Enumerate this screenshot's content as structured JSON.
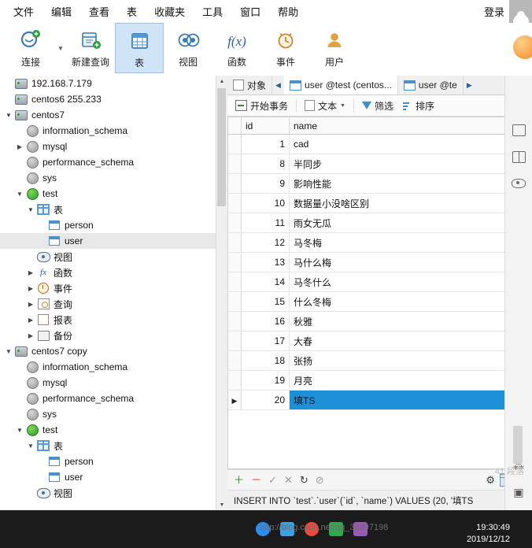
{
  "menu": {
    "items": [
      "文件",
      "编辑",
      "查看",
      "表",
      "收藏夹",
      "工具",
      "窗口",
      "帮助"
    ],
    "login_label": "登录",
    "avatar_name": "user-avatar"
  },
  "ribbon": {
    "buttons": [
      {
        "label": "连接",
        "icon": "connection-icon",
        "selected": false,
        "has_caret": true
      },
      {
        "label": "新建查询",
        "icon": "new-query-icon",
        "selected": false,
        "has_caret": false
      },
      {
        "label": "表",
        "icon": "table-icon",
        "selected": true,
        "has_caret": false
      },
      {
        "label": "视图",
        "icon": "view-icon",
        "selected": false,
        "has_caret": false
      },
      {
        "label": "函数",
        "icon": "function-icon",
        "selected": false,
        "has_caret": false
      },
      {
        "label": "事件",
        "icon": "event-icon",
        "selected": false,
        "has_caret": false
      },
      {
        "label": "用户",
        "icon": "user-icon",
        "selected": false,
        "has_caret": false
      }
    ],
    "expand_icon": "chevron-double-right-icon",
    "more_icon": "chevron-down-icon"
  },
  "tree": [
    {
      "label": "192.168.7.179",
      "icon": "server-icon",
      "indent": 0,
      "twisty": "",
      "selected": false
    },
    {
      "label": "centos6 255.233",
      "icon": "server-icon",
      "indent": 0,
      "twisty": "",
      "selected": false
    },
    {
      "label": "centos7",
      "icon": "server-icon-green",
      "indent": 0,
      "twisty": "collapse",
      "selected": false
    },
    {
      "label": "information_schema",
      "icon": "database-gray-icon",
      "indent": 1,
      "twisty": "",
      "selected": false
    },
    {
      "label": "mysql",
      "icon": "database-gray-icon",
      "indent": 1,
      "twisty": "expand",
      "selected": false
    },
    {
      "label": "performance_schema",
      "icon": "database-gray-icon",
      "indent": 1,
      "twisty": "",
      "selected": false
    },
    {
      "label": "sys",
      "icon": "database-gray-icon",
      "indent": 1,
      "twisty": "",
      "selected": false
    },
    {
      "label": "test",
      "icon": "database-green-icon",
      "indent": 1,
      "twisty": "collapse",
      "selected": false
    },
    {
      "label": "表",
      "icon": "tables-folder-icon",
      "indent": 2,
      "twisty": "collapse",
      "selected": false
    },
    {
      "label": "person",
      "icon": "table-grid-icon",
      "indent": 3,
      "twisty": "",
      "selected": false
    },
    {
      "label": "user",
      "icon": "table-grid-icon",
      "indent": 3,
      "twisty": "",
      "selected": true
    },
    {
      "label": "视图",
      "icon": "view-icon",
      "indent": 2,
      "twisty": "",
      "selected": false
    },
    {
      "label": "函数",
      "icon": "function-icon",
      "indent": 2,
      "twisty": "expand",
      "selected": false
    },
    {
      "label": "事件",
      "icon": "event-icon",
      "indent": 2,
      "twisty": "expand",
      "selected": false
    },
    {
      "label": "查询",
      "icon": "query-icon",
      "indent": 2,
      "twisty": "expand",
      "selected": false
    },
    {
      "label": "报表",
      "icon": "report-icon",
      "indent": 2,
      "twisty": "expand",
      "selected": false
    },
    {
      "label": "备份",
      "icon": "backup-icon",
      "indent": 2,
      "twisty": "expand",
      "selected": false
    },
    {
      "label": "centos7 copy",
      "icon": "server-icon-green",
      "indent": 0,
      "twisty": "collapse",
      "selected": false
    },
    {
      "label": "information_schema",
      "icon": "database-gray-icon",
      "indent": 1,
      "twisty": "",
      "selected": false
    },
    {
      "label": "mysql",
      "icon": "database-gray-icon",
      "indent": 1,
      "twisty": "",
      "selected": false
    },
    {
      "label": "performance_schema",
      "icon": "database-gray-icon",
      "indent": 1,
      "twisty": "",
      "selected": false
    },
    {
      "label": "sys",
      "icon": "database-gray-icon",
      "indent": 1,
      "twisty": "",
      "selected": false
    },
    {
      "label": "test",
      "icon": "database-green-icon",
      "indent": 1,
      "twisty": "collapse",
      "selected": false
    },
    {
      "label": "表",
      "icon": "tables-folder-icon",
      "indent": 2,
      "twisty": "collapse",
      "selected": false
    },
    {
      "label": "person",
      "icon": "table-grid-icon",
      "indent": 3,
      "twisty": "",
      "selected": false
    },
    {
      "label": "user",
      "icon": "table-grid-icon",
      "indent": 3,
      "twisty": "",
      "selected": false
    },
    {
      "label": "视图",
      "icon": "view-icon",
      "indent": 2,
      "twisty": "",
      "selected": false
    }
  ],
  "object_tabs": {
    "left_arrow": "chevron-left-icon",
    "right_arrow": "chevron-right-icon",
    "tabs": [
      {
        "label": "对象",
        "icon": "object-icon",
        "active": false
      },
      {
        "label": "user @test (centos...",
        "icon": "table-grid-icon",
        "active": true
      },
      {
        "label": "user @te",
        "icon": "table-grid-icon",
        "active": false
      }
    ]
  },
  "data_toolbar": {
    "begin_transaction": "开始事务",
    "text": "文本",
    "filter": "筛选",
    "sort": "排序"
  },
  "grid": {
    "columns": [
      "id",
      "name"
    ],
    "rows": [
      {
        "id": "1",
        "name": "cad"
      },
      {
        "id": "8",
        "name": "半同步"
      },
      {
        "id": "9",
        "name": "影响性能"
      },
      {
        "id": "10",
        "name": "数据量小没啥区别"
      },
      {
        "id": "11",
        "name": "雨女无瓜"
      },
      {
        "id": "12",
        "name": "马冬梅"
      },
      {
        "id": "13",
        "name": "马什么梅"
      },
      {
        "id": "14",
        "name": "马冬什么"
      },
      {
        "id": "15",
        "name": "什么冬梅"
      },
      {
        "id": "16",
        "name": "秋雅"
      },
      {
        "id": "17",
        "name": "大春"
      },
      {
        "id": "18",
        "name": "张扬"
      },
      {
        "id": "19",
        "name": "月亮"
      },
      {
        "id": "20",
        "name": "填TS"
      }
    ],
    "current_row_index": 13,
    "selected_cell": {
      "row": 13,
      "column": "name"
    }
  },
  "grid_nav": {
    "icons": [
      "add-record-icon",
      "delete-record-icon",
      "confirm-icon",
      "cancel-icon",
      "refresh-icon",
      "stop-icon"
    ],
    "settings_icon": "gear-icon",
    "grid_view_icon": "grid-view-icon",
    "form_view_icon": "form-view-icon"
  },
  "sql_bar": {
    "statement": "INSERT INTO `test`.`user`(`id`, `name`) VALUES (20, '填TS",
    "close_icon": "close-icon"
  },
  "rail": {
    "icons": [
      "panel-icon",
      "split-panel-icon",
      "eye-icon",
      "target-icon",
      "chart-icon",
      "window-icon"
    ]
  },
  "taskbar": {
    "time": "19:30:49",
    "date": "2019/12/12",
    "watermark": "http://blog.csdn.net/qq_33997198",
    "note": "41 段落"
  }
}
